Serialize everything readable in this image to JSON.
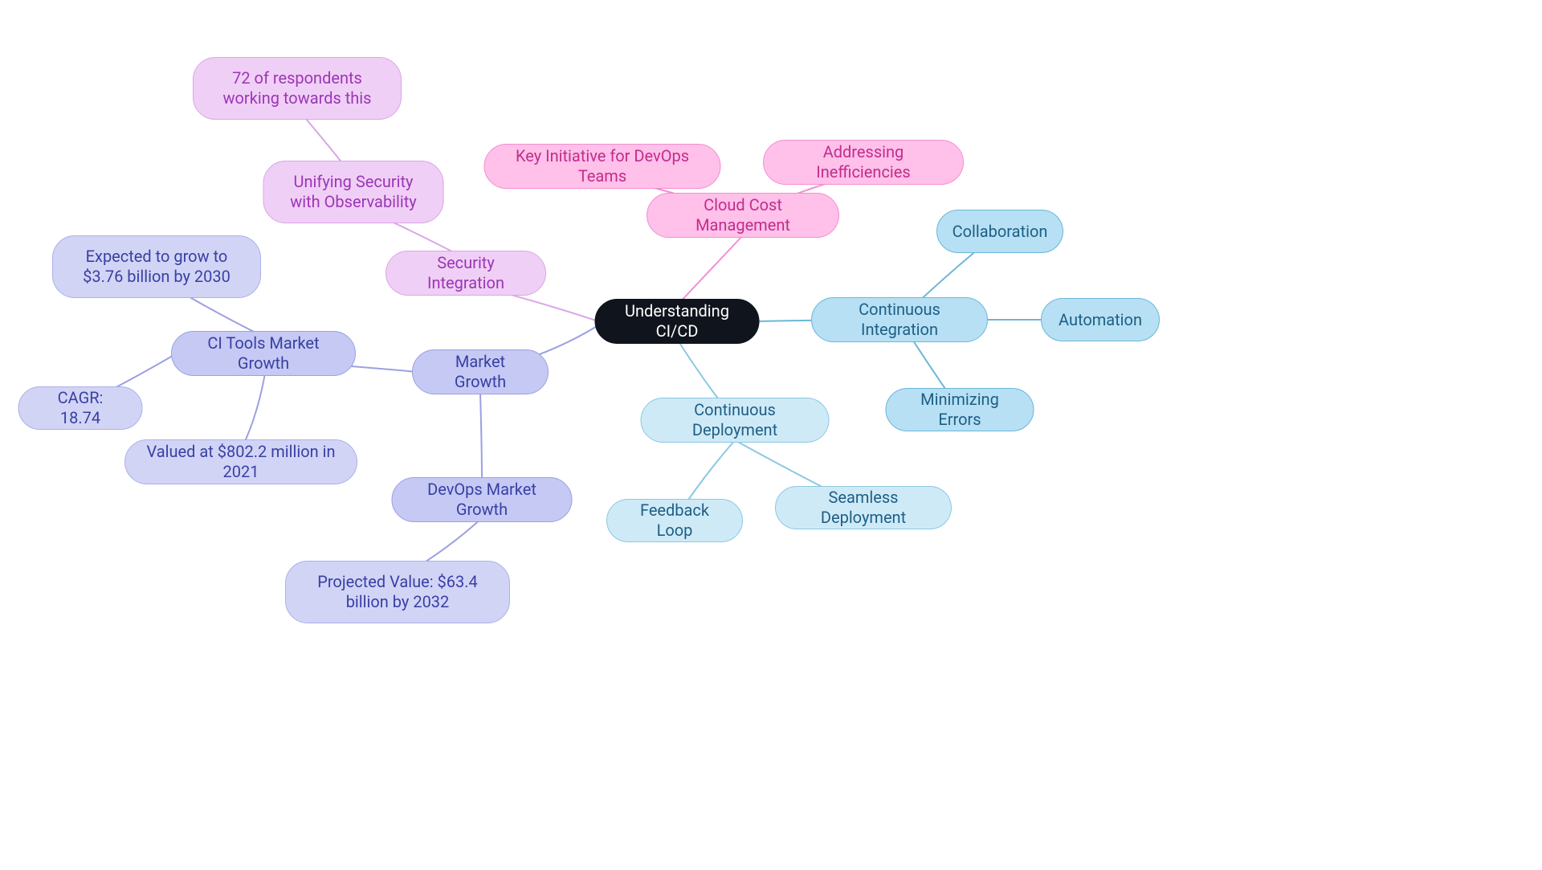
{
  "center": {
    "label": "Understanding CI/CD"
  },
  "ci": {
    "label": "Continuous Integration",
    "children": {
      "collaboration": "Collaboration",
      "automation": "Automation",
      "min_errors": "Minimizing Errors"
    }
  },
  "cd": {
    "label": "Continuous Deployment",
    "children": {
      "feedback": "Feedback Loop",
      "seamless": "Seamless Deployment"
    }
  },
  "cloud": {
    "label": "Cloud Cost Management",
    "children": {
      "key_init": "Key Initiative for DevOps Teams",
      "addr_ineff": "Addressing Inefficiencies"
    }
  },
  "security": {
    "label": "Security Integration",
    "unify": "Unifying Security with Observability",
    "respondents": "72 of respondents working towards this"
  },
  "market": {
    "label": "Market Growth",
    "ci_tools": {
      "label": "CI Tools Market Growth",
      "grow_2030": "Expected to grow to $3.76 billion by 2030",
      "cagr": "CAGR: 18.74",
      "valued_2021": "Valued at $802.2 million in 2021"
    },
    "devops": {
      "label": "DevOps Market Growth",
      "projected": "Projected Value: $63.4 billion by 2032"
    }
  }
}
